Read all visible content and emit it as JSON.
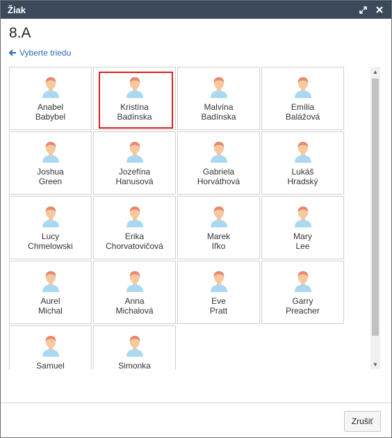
{
  "window": {
    "title": "Žiak",
    "expand_icon": "expand-icon",
    "close_icon": "close-icon"
  },
  "header": {
    "class_name": "8.A",
    "back_link": "Vyberte triedu"
  },
  "students": [
    {
      "first": "Anabel",
      "last": "Babybel"
    },
    {
      "first": "Kristína",
      "last": "Badínska",
      "selected": true
    },
    {
      "first": "Malvína",
      "last": "Badínska"
    },
    {
      "first": "Emília",
      "last": "Balážová"
    },
    {
      "first": "Joshua",
      "last": "Green"
    },
    {
      "first": "Jozefína",
      "last": "Hanusová"
    },
    {
      "first": "Gabriela",
      "last": "Horváthová"
    },
    {
      "first": "Lukáš",
      "last": "Hradský"
    },
    {
      "first": "Lucy",
      "last": "Chmelowski"
    },
    {
      "first": "Erika",
      "last": "Chorvatovičová"
    },
    {
      "first": "Marek",
      "last": "Iľko"
    },
    {
      "first": "Mary",
      "last": "Lee"
    },
    {
      "first": "Aurel",
      "last": "Michal"
    },
    {
      "first": "Anna",
      "last": "Michalová"
    },
    {
      "first": "Eve",
      "last": "Pratt"
    },
    {
      "first": "Garry",
      "last": "Preacher"
    },
    {
      "first": "Samuel",
      "last": ""
    },
    {
      "first": "Simonka",
      "last": ""
    }
  ],
  "footer": {
    "close_label": "Zrušiť"
  },
  "colors": {
    "titlebar": "#3b4a5a",
    "link": "#2a6bb5",
    "selection": "#e01c1c",
    "avatar_skin": "#f6c89f",
    "avatar_hair": "#e8876b",
    "avatar_shirt": "#a9d8f2"
  }
}
